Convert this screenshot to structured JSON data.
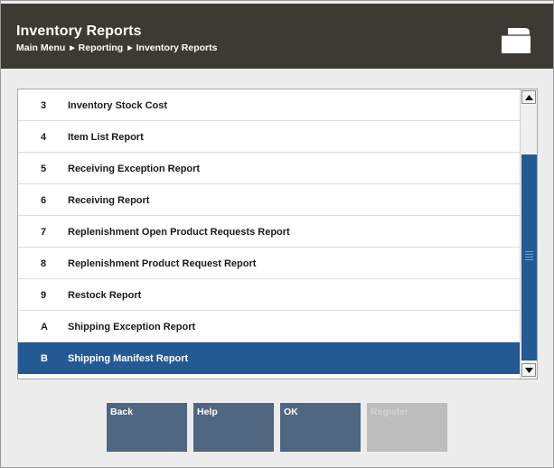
{
  "header": {
    "title": "Inventory Reports",
    "breadcrumb": [
      "Main Menu",
      "Reporting",
      "Inventory Reports"
    ]
  },
  "list": {
    "items": [
      {
        "key": "3",
        "label": "Inventory Stock Cost"
      },
      {
        "key": "4",
        "label": "Item List Report"
      },
      {
        "key": "5",
        "label": "Receiving Exception Report"
      },
      {
        "key": "6",
        "label": "Receiving Report"
      },
      {
        "key": "7",
        "label": "Replenishment Open Product Requests Report"
      },
      {
        "key": "8",
        "label": "Replenishment Product Request Report"
      },
      {
        "key": "9",
        "label": "Restock Report"
      },
      {
        "key": "A",
        "label": "Shipping Exception Report"
      },
      {
        "key": "B",
        "label": "Shipping Manifest Report",
        "selected": true
      }
    ]
  },
  "buttons": {
    "back": "Back",
    "help": "Help",
    "ok": "OK",
    "register": "Register"
  },
  "icons": {
    "header_icon": "folder-icon",
    "breadcrumb_separator": "triangle-right-icon",
    "scroll_up": "arrow-up-icon",
    "scroll_down": "arrow-down-icon"
  },
  "colors": {
    "header_bg": "#3d3a35",
    "selected_row": "#245a93",
    "button_bg": "#4f6780",
    "button_disabled": "#bdbdbd"
  }
}
